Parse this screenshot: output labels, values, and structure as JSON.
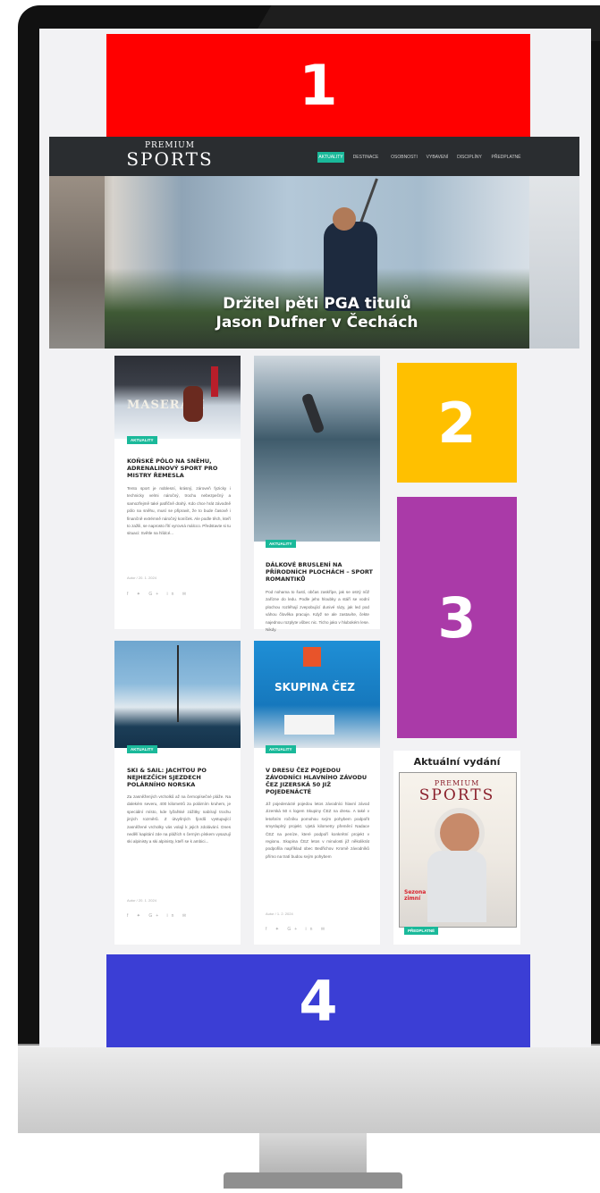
{
  "placeholders": {
    "ad1": "1",
    "ad2": "2",
    "ad3": "3",
    "ad4": "4"
  },
  "site": {
    "logo_top": "PREMIUM",
    "logo_bottom": "SPORTS",
    "nav": [
      "AKTUALITY",
      "DESTINACE",
      "OSOBNOSTI",
      "VYBAVENÍ",
      "DISCIPLÍNY",
      "PŘEDPLATNÉ"
    ],
    "nav_active": "AKTUALITY"
  },
  "hero": {
    "title_line1": "Držitel pěti PGA titulů",
    "title_line2": "Jason Dufner v Čechách"
  },
  "articles": [
    {
      "tag": "AKTUALITY",
      "title": "KOŇSKÉ PÓLO NA SNĚHU, ADRENALINOVÝ SPORT PRO MISTRY ŘEMESLA",
      "excerpt": "Tento sport je noblesní, krásný, zároveň fyzicky i technicky velmi náročný, trochu nebezpečný a samozřejmě také patřičně drahý. Kdo chce hrát závodně pólo na sněhu, musí se připravit, že to bude časově i finančně extrémně náročný koníček. Ale podle těch, kteří to zažili, se naprosto řítí vyrovná málcco. Představte si tu situaci: Světle na hlídcé...",
      "meta": "Autor / 20. 1. 2024",
      "image_text": "MASERATI"
    },
    {
      "tag": "AKTUALITY",
      "title": "DÁLKOVÉ BRUSLENÍ NA PŘÍRODNÍCH PLOCHÁCH – SPORT ROMANTIKŮ",
      "excerpt": "Pod nohama to šustí, občas zaskřípe, jak se ostrý nůž zařízne do ledu. Podle jeho hloubky a stáří se vodní plochou rozléhají zvepobující dunivé rázy, jak led pod váhou člověka pracuje. Když se ale zastavíte, čekte najednou rozplyte vůbec nic. Ticho jako v hlubokém lese. Nikdy.",
      "meta": ""
    },
    {
      "tag": "AKTUALITY",
      "title": "SKI & SAIL: JACHTOU PO NEJHEZČÍCH SJEZDECH POLÁRNÍHO NORSKA",
      "excerpt": "Za zasněžených vrcholků až na černopísečné pláže. Na dalekém severu, 400 kilometrů za polárním kruhem, je speciální místo, kde lyžařské zážitky nabírají trochu jiných rozměrů. Z útvyšných fjordů vystupující zasněžené vrcholky vás volají k jejich zdolávání. Dnes nedělí kapitání zde na plážích s černým pískem vysazují ski alpinisty a ski alpinisty, kteří se k ambici...",
      "meta": "Autor / 20. 1. 2024"
    },
    {
      "tag": "AKTUALITY",
      "title": "V DRESU ČEZ POJEDOU ZÁVODNÍCI HLAVNÍHO ZÁVODU ČEZ JIZERSKÁ 50 JIŽ POJEDENÁCTÉ",
      "excerpt": "Již pojedenácté pojedou letos závodníci hlavní závod Jizerská 50 s logem Skupiny ČEZ na dresu. A také v letošním ročníku pomohou svým pohybem podpořit smysluplný projekt. Ujetá kilometry přemění Nadace ČEZ na peníze, které podpoří konkrétní projekt v regionu. Skupina ČEZ letos v minulosti již několikrát podpořila například obec Bedřichov. Kromě závodníků přímo na tratí budou svým pohybem",
      "meta": "Autor / 1. 2. 2024",
      "image_text": "SKUPINA ČEZ"
    }
  ],
  "share_icons": "f ✦ G+ in ✉",
  "sidebar": {
    "title": "Aktuální vydání",
    "mag_top": "PREMIUM",
    "mag_bottom": "SPORTS",
    "mag_badge": "Sezona zimní",
    "button": "PŘEDPLATNÉ"
  },
  "colors": {
    "accent": "#1ab99a",
    "ad1": "#ff0000",
    "ad2": "#ffc000",
    "ad3": "#aa3aa8",
    "ad4": "#3b3ed5"
  }
}
